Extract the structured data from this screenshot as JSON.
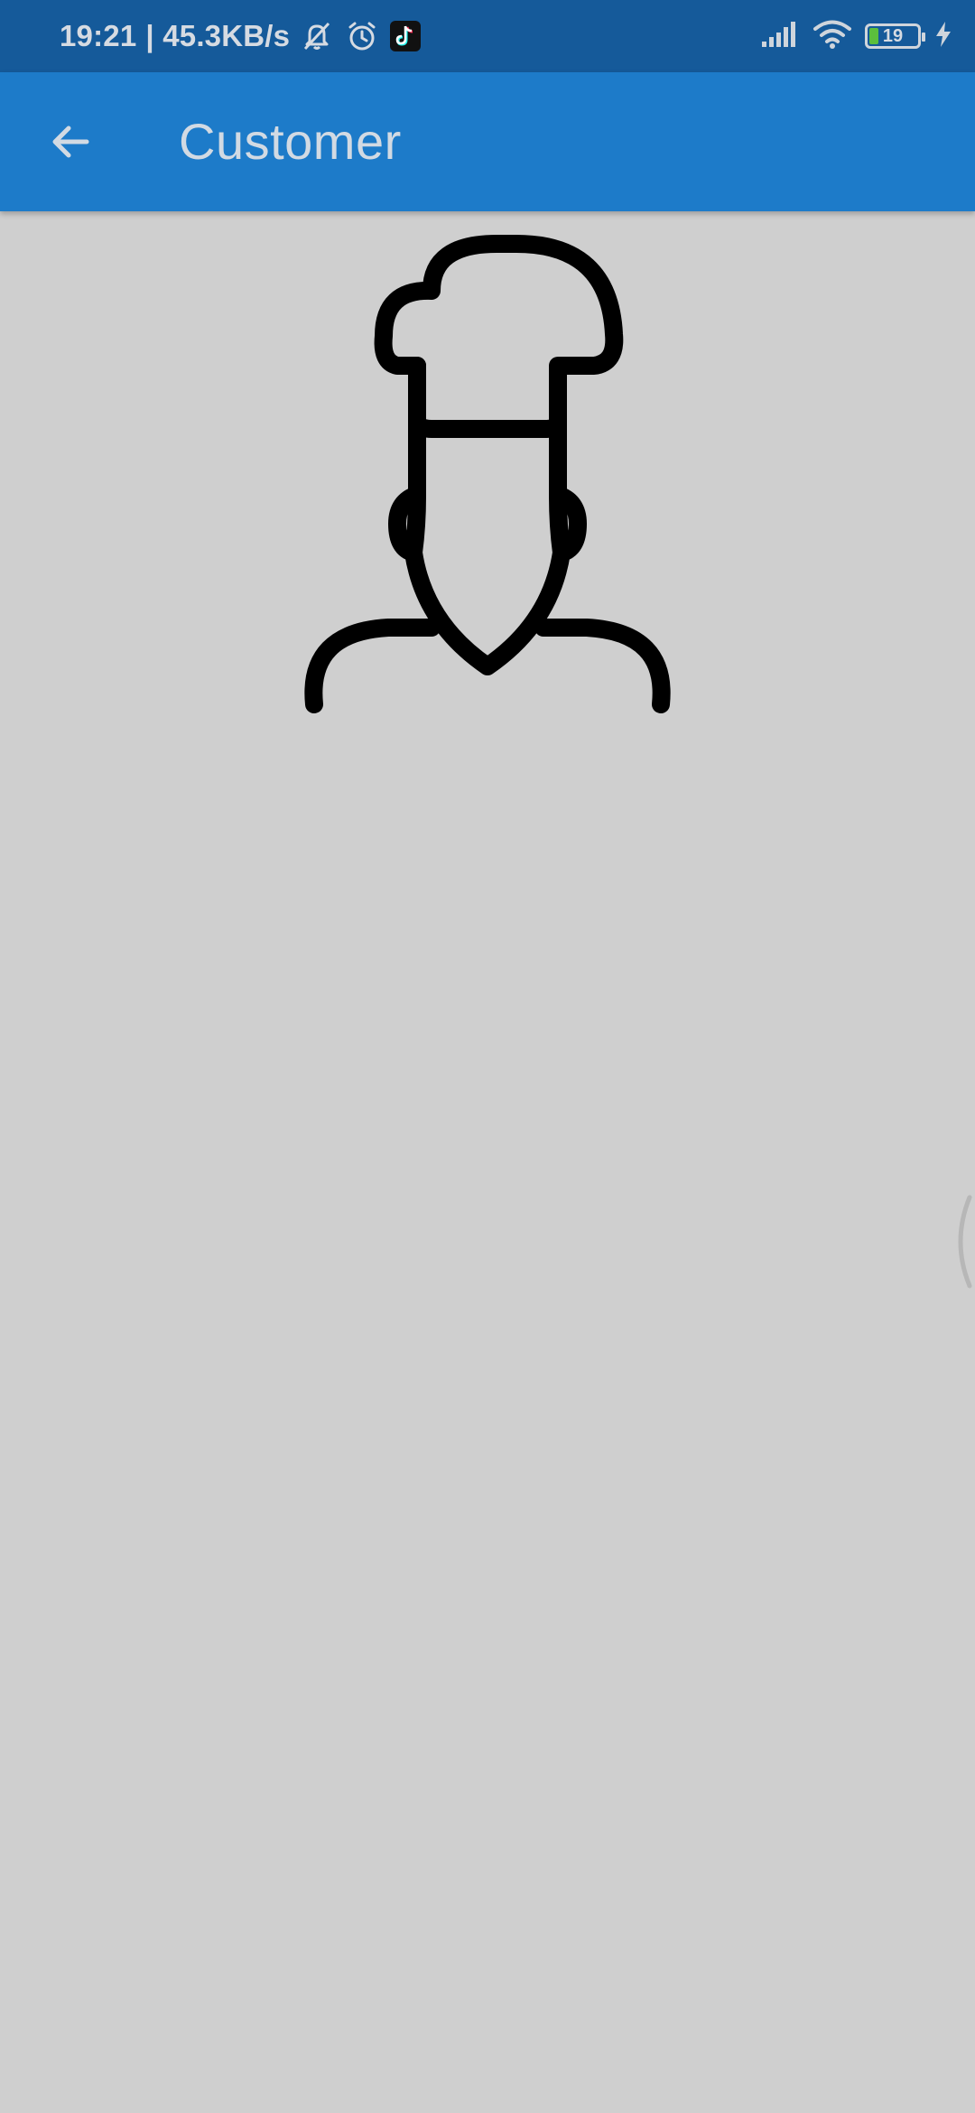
{
  "status_bar": {
    "time": "19:21",
    "network_speed": "| 45.3KB/s",
    "icons": [
      "bell-off-icon",
      "alarm-icon",
      "tiktok-icon",
      "signal-icon",
      "wifi-icon",
      "charging-icon"
    ],
    "battery_level": "19",
    "battery_fraction": 0.19
  },
  "app_bar": {
    "title": "Customer",
    "back_icon": "arrow-left-icon",
    "color": "#1d7bc9"
  },
  "content": {
    "illustration": "chef-icon"
  },
  "colors": {
    "status_bar": "#155a9a",
    "background": "#cfcfcf"
  }
}
